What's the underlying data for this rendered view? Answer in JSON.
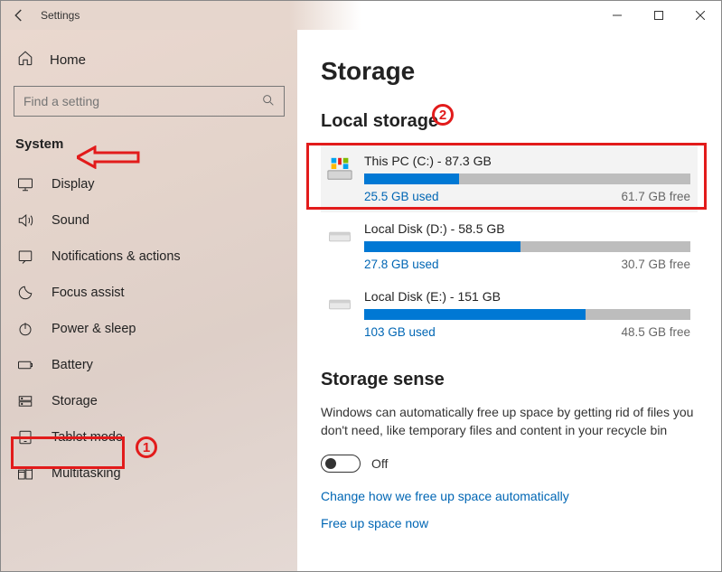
{
  "window": {
    "title": "Settings"
  },
  "sidebar": {
    "home": "Home",
    "search_placeholder": "Find a setting",
    "section": "System",
    "items": [
      {
        "label": "Display"
      },
      {
        "label": "Sound"
      },
      {
        "label": "Notifications & actions"
      },
      {
        "label": "Focus assist"
      },
      {
        "label": "Power & sleep"
      },
      {
        "label": "Battery"
      },
      {
        "label": "Storage"
      },
      {
        "label": "Tablet mode"
      },
      {
        "label": "Multitasking"
      }
    ]
  },
  "main": {
    "title": "Storage",
    "local_heading": "Local storage",
    "drives": [
      {
        "title": "This PC (C:) - 87.3 GB",
        "used": "25.5 GB used",
        "free": "61.7 GB free",
        "pct": 29
      },
      {
        "title": "Local Disk (D:) - 58.5 GB",
        "used": "27.8 GB used",
        "free": "30.7 GB free",
        "pct": 48
      },
      {
        "title": "Local Disk (E:) - 151 GB",
        "used": "103 GB used",
        "free": "48.5 GB free",
        "pct": 68
      }
    ],
    "sense_heading": "Storage sense",
    "sense_desc": "Windows can automatically free up space by getting rid of files you don't need, like temporary files and content in your recycle bin",
    "toggle_state": "Off",
    "link1": "Change how we free up space automatically",
    "link2": "Free up space now"
  },
  "annotations": {
    "num1": "1",
    "num2": "2"
  }
}
